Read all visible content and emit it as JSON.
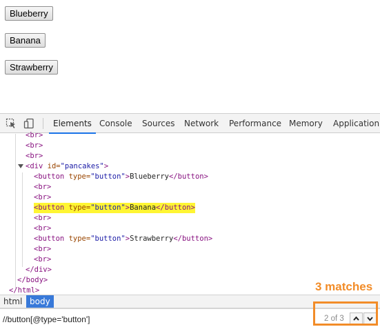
{
  "page": {
    "buttons": [
      "Blueberry",
      "Banana",
      "Strawberry"
    ]
  },
  "devtools": {
    "tabs": [
      "Elements",
      "Console",
      "Sources",
      "Network",
      "Performance",
      "Memory",
      "Application"
    ],
    "active_tab": "Elements",
    "dom": {
      "br": "<br>",
      "div_open_tag": "<div",
      "div_attr_name": " id=",
      "div_attr_value": "\"pancakes\"",
      "close_angle": ">",
      "button_open_tag": "<button",
      "button_attr_name": " type=",
      "button_attr_value": "\"button\"",
      "button_close_tag": "</button>",
      "button_texts": [
        "Blueberry",
        "Banana",
        "Strawberry"
      ],
      "highlighted_line": "<button type=\"button\">Banana</button>",
      "div_close": "</div>",
      "body_close": "</body>",
      "html_close": "</html>"
    },
    "breadcrumb": [
      "html",
      "body"
    ],
    "search": {
      "value": "//button[@type='button']",
      "match_count": "2 of 3"
    }
  },
  "annotation": {
    "text": "3 matches",
    "color": "#f28c28"
  },
  "colors": {
    "highlight": "#fff533",
    "tab_accent": "#1a73e8",
    "crumb_selected": "#3879d9"
  }
}
